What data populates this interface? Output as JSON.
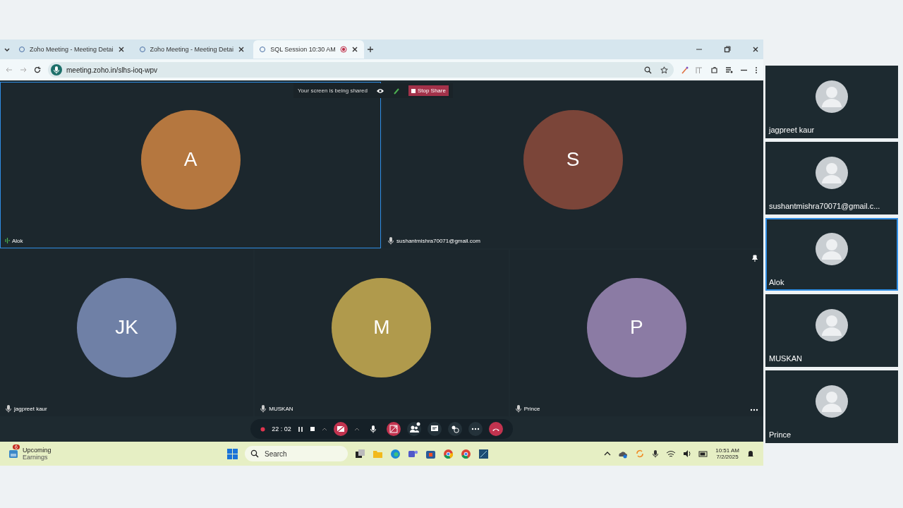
{
  "tabs": [
    {
      "title": "Zoho Meeting - Meeting Detai",
      "selected": false,
      "recording": false
    },
    {
      "title": "Zoho Meeting - Meeting Detai",
      "selected": false,
      "recording": false
    },
    {
      "title": "SQL Session 10:30 AM",
      "selected": true,
      "recording": true
    }
  ],
  "address": "meeting.zoho.in/slhs-ioq-wpv",
  "share_banner": {
    "message": "Your screen is being shared",
    "stop_label": "Stop Share"
  },
  "participants": [
    {
      "initial": "A",
      "name": "Alok",
      "color": "#b5773f",
      "active": true
    },
    {
      "initial": "S",
      "name": "sushantmishra70071@gmail.com",
      "color": "#7b4539",
      "active": false
    },
    {
      "initial": "JK",
      "name": "jagpreet kaur",
      "color": "#6f80a6",
      "active": false
    },
    {
      "initial": "M",
      "name": "MUSKAN",
      "color": "#b09a4c",
      "active": false
    },
    {
      "initial": "P",
      "name": "Prince",
      "color": "#8b7ba4",
      "active": false
    }
  ],
  "controls": {
    "timer": "22 : 02"
  },
  "side_tiles": [
    {
      "name": "jagpreet kaur",
      "selected": false
    },
    {
      "name": "sushantmishra70071@gmail.c...",
      "selected": false
    },
    {
      "name": "Alok",
      "selected": true
    },
    {
      "name": "MUSKAN",
      "selected": false
    },
    {
      "name": "Prince",
      "selected": false
    }
  ],
  "taskbar": {
    "widget_badge": "6",
    "widget_title": "Upcoming",
    "widget_subtitle": "Earnings",
    "search_placeholder": "Search",
    "time": "10:51 AM",
    "date": "7/2/2025"
  }
}
